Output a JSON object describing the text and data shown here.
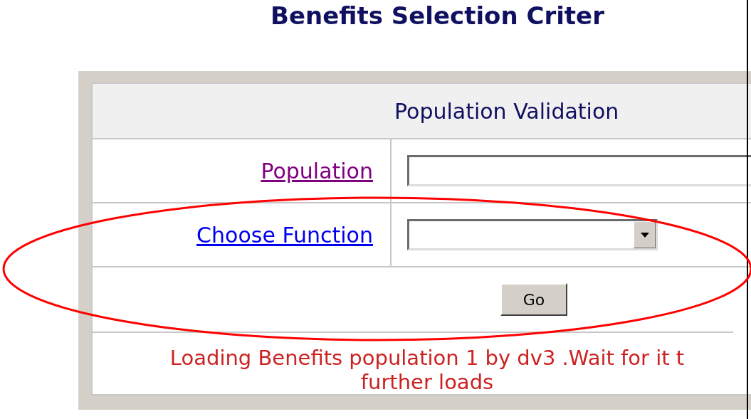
{
  "page_title": "Benefits Selection Criter",
  "form": {
    "title": "Population Validation",
    "fields": [
      {
        "kind": "text",
        "label": "Population",
        "visited": true
      },
      {
        "kind": "select",
        "label": "Choose Function",
        "visited": false
      }
    ],
    "button": "Go",
    "message_lines": [
      "Loading Benefits population 1 by dv3 .Wait for it t",
      "further loads"
    ]
  },
  "annotations": [
    {
      "kind": "ellipse"
    }
  ]
}
